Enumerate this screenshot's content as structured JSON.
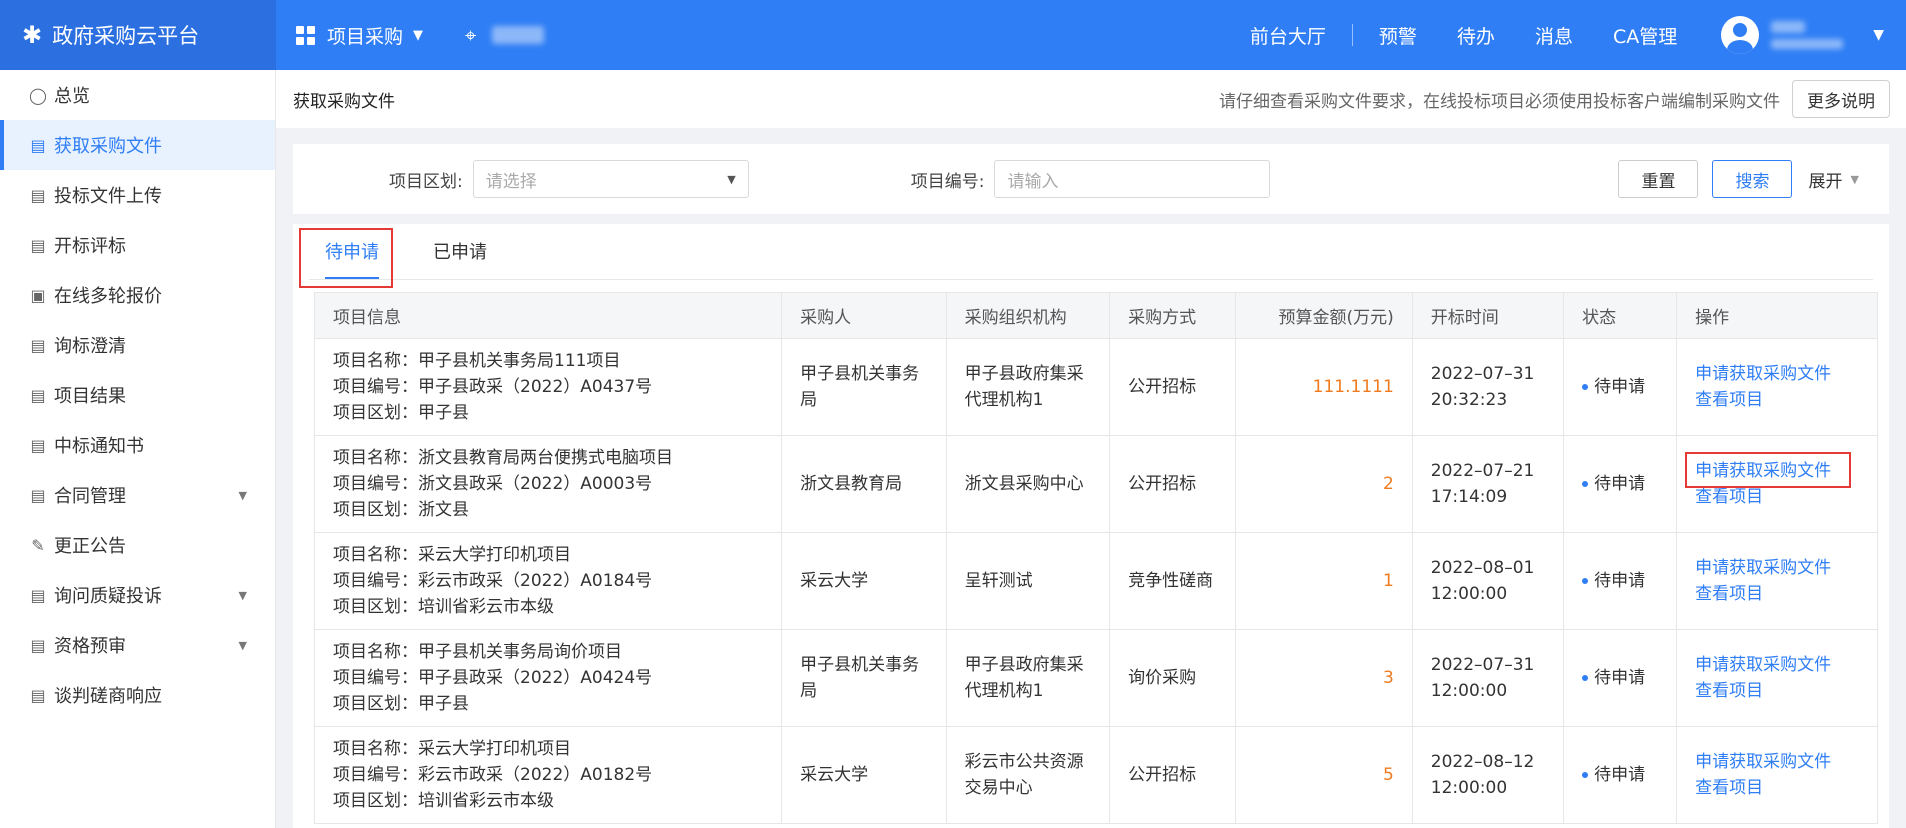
{
  "header": {
    "brand_icon": "✱",
    "brand": "政府采购云平台",
    "project_menu": "项目采购",
    "nav": [
      "前台大厅",
      "预警",
      "待办",
      "消息",
      "CA管理"
    ]
  },
  "sidebar": {
    "items": [
      {
        "label": "总览",
        "icon": "◯"
      },
      {
        "label": "获取采购文件",
        "icon": "▤"
      },
      {
        "label": "投标文件上传",
        "icon": "▤"
      },
      {
        "label": "开标评标",
        "icon": "▤"
      },
      {
        "label": "在线多轮报价",
        "icon": "▣"
      },
      {
        "label": "询标澄清",
        "icon": "▤"
      },
      {
        "label": "项目结果",
        "icon": "▤"
      },
      {
        "label": "中标通知书",
        "icon": "▤"
      },
      {
        "label": "合同管理",
        "icon": "▤"
      },
      {
        "label": "更正公告",
        "icon": "✎"
      },
      {
        "label": "询问质疑投诉",
        "icon": "▤"
      },
      {
        "label": "资格预审",
        "icon": "▤"
      },
      {
        "label": "谈判磋商响应",
        "icon": "▤"
      }
    ]
  },
  "page": {
    "title": "获取采购文件",
    "notice": "请仔细查看采购文件要求，在线投标项目必须使用投标客户端编制采购文件",
    "more_btn": "更多说明"
  },
  "filter": {
    "region_label": "项目区划:",
    "region_placeholder": "请选择",
    "code_label": "项目编号:",
    "code_placeholder": "请输入",
    "reset": "重置",
    "search": "搜索",
    "expand": "展开"
  },
  "tabs": [
    "待申请",
    "已申请"
  ],
  "table": {
    "headers": [
      "项目信息",
      "采购人",
      "采购组织机构",
      "采购方式",
      "预算金额(万元)",
      "开标时间",
      "状态",
      "操作"
    ],
    "rows": [
      {
        "name": "项目名称：甲子县机关事务局111项目",
        "code": "项目编号：甲子县政采（2022）A0437号",
        "region": "项目区划：甲子县",
        "buyer": "甲子县机关事务局",
        "agency": "甲子县政府集采代理机构1",
        "method": "公开招标",
        "budget": "111.1111",
        "date": "2022–07–31",
        "time": "20:32:23",
        "status": "待申请",
        "op1": "申请获取采购文件",
        "op2": "查看项目"
      },
      {
        "name": "项目名称：浙文县教育局两台便携式电脑项目",
        "code": "项目编号：浙文县政采（2022）A0003号",
        "region": "项目区划：浙文县",
        "buyer": "浙文县教育局",
        "agency": "浙文县采购中心",
        "method": "公开招标",
        "budget": "2",
        "date": "2022–07–21",
        "time": "17:14:09",
        "status": "待申请",
        "op1": "申请获取采购文件",
        "op2": "查看项目"
      },
      {
        "name": "项目名称：采云大学打印机项目",
        "code": "项目编号：彩云市政采（2022）A0184号",
        "region": "项目区划：培训省彩云市本级",
        "buyer": "采云大学",
        "agency": "呈轩测试",
        "method": "竞争性磋商",
        "budget": "1",
        "date": "2022–08–01",
        "time": "12:00:00",
        "status": "待申请",
        "op1": "申请获取采购文件",
        "op2": "查看项目"
      },
      {
        "name": "项目名称：甲子县机关事务局询价项目",
        "code": "项目编号：甲子县政采（2022）A0424号",
        "region": "项目区划：甲子县",
        "buyer": "甲子县机关事务局",
        "agency": "甲子县政府集采代理机构1",
        "method": "询价采购",
        "budget": "3",
        "date": "2022–07–31",
        "time": "12:00:00",
        "status": "待申请",
        "op1": "申请获取采购文件",
        "op2": "查看项目"
      },
      {
        "name": "项目名称：采云大学打印机项目",
        "code": "项目编号：彩云市政采（2022）A0182号",
        "region": "项目区划：培训省彩云市本级",
        "buyer": "采云大学",
        "agency": "彩云市公共资源交易中心",
        "method": "公开招标",
        "budget": "5",
        "date": "2022–08–12",
        "time": "12:00:00",
        "status": "待申请",
        "op1": "申请获取采购文件",
        "op2": "查看项目"
      }
    ]
  },
  "colors": {
    "primary": "#2f7ef5",
    "accent_orange": "#f07b1e",
    "highlight_red": "#e53935"
  }
}
